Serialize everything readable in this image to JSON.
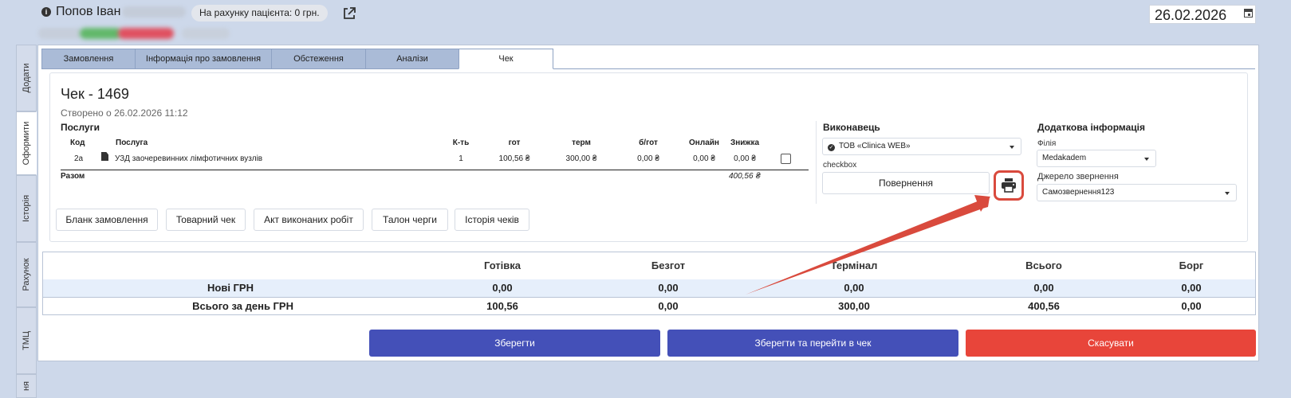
{
  "header": {
    "patient_name": "Попов Іван",
    "balance": "На рахунку пацієнта: 0 грн.",
    "date": "26.02.2026"
  },
  "side_tabs": [
    "Додати",
    "Оформити",
    "Історія",
    "Рахунок",
    "ТМЦ",
    "ня"
  ],
  "tabs": [
    "Замовлення",
    "Інформація про замовлення",
    "Обстеження",
    "Аналізи",
    "Чек"
  ],
  "receipt": {
    "title": "Чек - 1469",
    "created": "Створено о 26.02.2026 11:12",
    "services_title": "Послуги",
    "columns": [
      "Код",
      "Послуга",
      "К-ть",
      "гот",
      "терм",
      "б/гот",
      "Онлайн",
      "Знижка"
    ],
    "row": {
      "code": "2а",
      "service": "УЗД заочеревинних лімфотичних вузлів",
      "qty": "1",
      "cash": "100,56 ₴",
      "terminal": "300,00 ₴",
      "noncash": "0,00 ₴",
      "online": "0,00 ₴",
      "discount": "0,00 ₴"
    },
    "total_label": "Разом",
    "total_value": "400,56 ₴"
  },
  "doc_buttons": [
    "Бланк замовлення",
    "Товарний чек",
    "Акт виконаних робіт",
    "Талон черги",
    "Історія чеків"
  ],
  "executor": {
    "title": "Виконавець",
    "value": "ТОВ «Clinica WEB»",
    "checkbox_label": "checkbox",
    "return_button": "Повернення"
  },
  "additional": {
    "title": "Додаткова інформація",
    "branch_label": "Філія",
    "branch_value": "Medakadem",
    "source_label": "Джерело звернення",
    "source_value": "Самозвернення123"
  },
  "summary": {
    "headers": [
      "Готівка",
      "Безгот",
      "Термінал",
      "Всього",
      "Борг"
    ],
    "rows": [
      {
        "label": "Нові ГРН",
        "values": [
          "0,00",
          "0,00",
          "0,00",
          "0,00",
          "0,00"
        ]
      },
      {
        "label": "Всього за день ГРН",
        "values": [
          "100,56",
          "0,00",
          "300,00",
          "400,56",
          "0,00"
        ]
      }
    ]
  },
  "actions": {
    "save": "Зберегти",
    "save_and_go": "Зберегти та перейти в чек",
    "cancel": "Скасувати"
  },
  "colors": {
    "primary": "#4450b8",
    "danger": "#e8453a",
    "highlight": "#d94a3d"
  }
}
